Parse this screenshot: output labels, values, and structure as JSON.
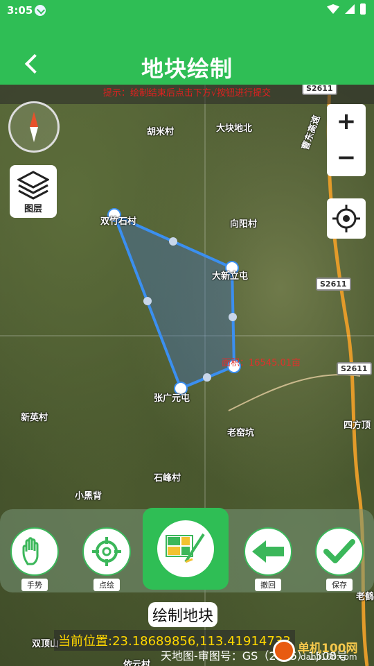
{
  "status_bar": {
    "time": "3:05"
  },
  "header": {
    "title": "地块绘制"
  },
  "hint": "提示：绘制结束后点击下方√按钮进行提交",
  "map_labels": [
    {
      "text": "胡米村"
    },
    {
      "text": "大块地北"
    },
    {
      "text": "双竹石村"
    },
    {
      "text": "向阳村"
    },
    {
      "text": "大新立屯"
    },
    {
      "text": "新英村"
    },
    {
      "text": "张广元屯"
    },
    {
      "text": "老窑坑"
    },
    {
      "text": "四方顶"
    },
    {
      "text": "石峰村"
    },
    {
      "text": "小黑背"
    },
    {
      "text": "双顶山"
    },
    {
      "text": "依云村"
    },
    {
      "text": "老鹤"
    },
    {
      "text": "曹东高速"
    }
  ],
  "road_badges": [
    "S2611",
    "S2611",
    "S2611"
  ],
  "area_text": "面积：16545.01亩",
  "layer_button": {
    "label": "图层"
  },
  "zoom": {
    "in_label": "+",
    "out_label": "−"
  },
  "tools": [
    {
      "label": "手势",
      "icon": "hand-icon"
    },
    {
      "label": "点绘",
      "icon": "target-icon"
    },
    {
      "label": "撤回",
      "icon": "arrow-left-icon"
    },
    {
      "label": "保存",
      "icon": "check-icon"
    }
  ],
  "draw_button": {
    "label": "绘制地块",
    "icon": "draw-plot-icon"
  },
  "current_position": "当前位置:23.18689856,113.41914733",
  "copyright": "天地图-审图号：GS（2015）1508号",
  "watermark": {
    "brand": "单机100网",
    "domain": "danji100.com"
  },
  "colors": {
    "primary": "#2fbe55",
    "polygon_stroke": "#3b8ff0",
    "hint_text": "#e02020",
    "position_text": "#ffd700"
  }
}
